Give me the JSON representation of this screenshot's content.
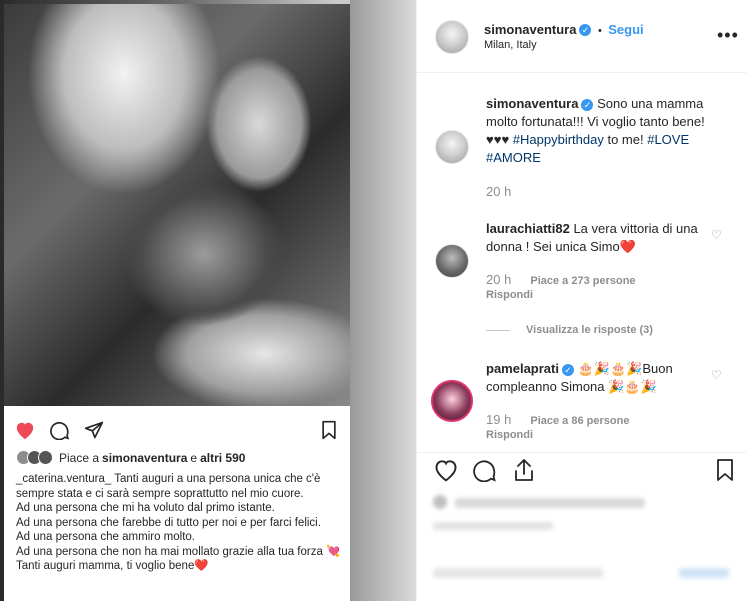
{
  "story": {
    "likes_prefix": "Piace a",
    "likes_user": "simonaventura",
    "likes_suffix": "e",
    "likes_others": "altri 590",
    "lines": [
      {
        "user": "_caterina.ventura_",
        "text": " Tanti auguri a una persona unica che c'è sempre stata e ci sarà sempre soprattutto nel mio cuore."
      },
      {
        "user": "",
        "text": "Ad una persona che mi ha voluto dal primo istante."
      },
      {
        "user": "",
        "text": "Ad una persona che farebbe di tutto per noi e per farci felici."
      },
      {
        "user": "",
        "text": "Ad una persona che ammiro molto."
      },
      {
        "user": "",
        "text": "Ad una persona che non ha mai mollato grazie alla tua forza 💘"
      },
      {
        "user": "",
        "text": "Tanti auguri mamma, ti voglio bene❤️"
      }
    ]
  },
  "header": {
    "username": "simonaventura",
    "verified_mark": "✓",
    "separator": "•",
    "follow_label": "Segui",
    "location": "Milan, Italy",
    "more_label": "•••"
  },
  "caption": {
    "username": "simonaventura",
    "text": "Sono una mamma molto fortunata!!! Vi voglio tanto bene! ♥♥♥",
    "hashtag1": "#Happybirthday",
    "text2": " to me!",
    "hashtag2": "#LOVE",
    "hashtag3": "#AMORE",
    "time": "20 h"
  },
  "comments": [
    {
      "username": "laurachiatti82",
      "text": "La vera vittoria di una donna ! Sei unica Simo❤️",
      "time": "20 h",
      "likes": "Piace a 273 persone",
      "reply": "Rispondi"
    },
    {
      "username": "pamelaprati",
      "text": "🎂🎉🎂🎉Buon compleanno Simona 🎉🎂🎉",
      "time": "19 h",
      "likes": "Piace a 86 persone",
      "reply": "Rispondi"
    }
  ],
  "view_replies": "Visualizza le risposte (3)",
  "colors": {
    "accent": "#3897f0",
    "like_red": "#ed4956",
    "text": "#262626",
    "muted": "#8e8e8e",
    "hashtag": "#003569"
  }
}
